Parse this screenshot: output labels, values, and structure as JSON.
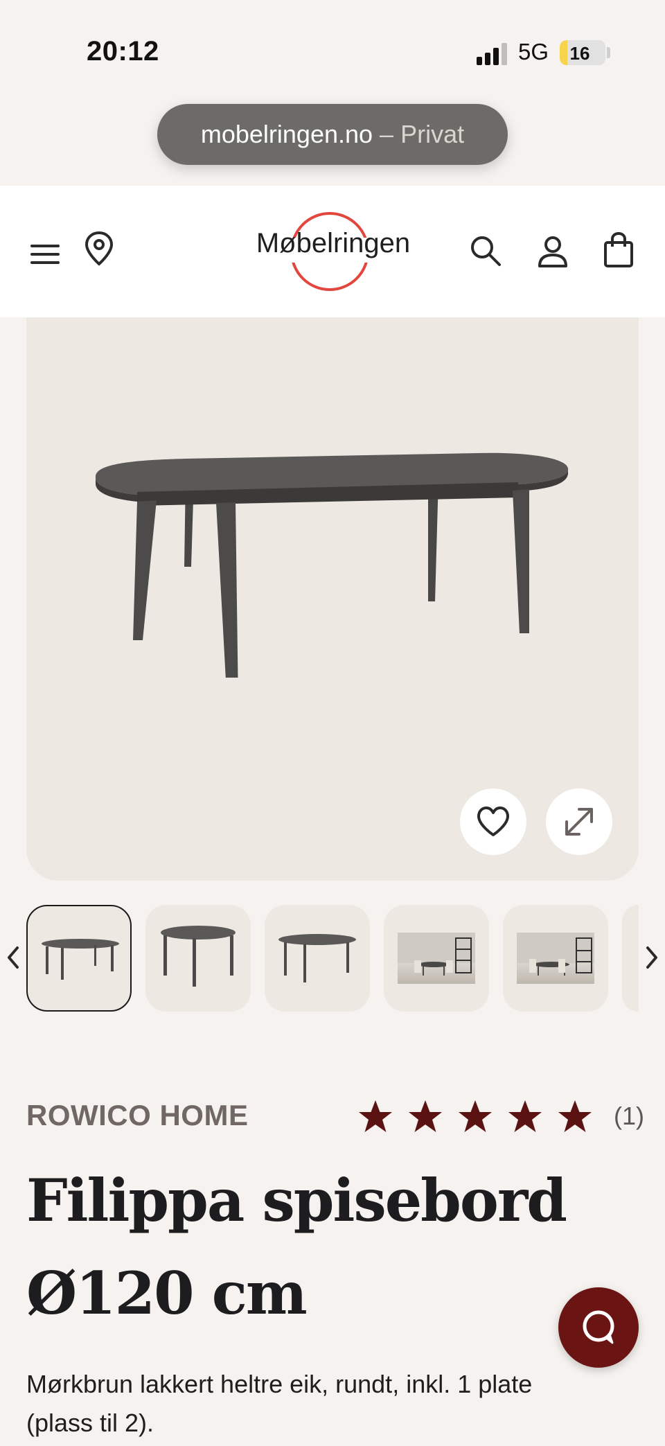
{
  "status_bar": {
    "time": "20:12",
    "network": "5G",
    "battery_level": "16",
    "battery_fraction": 0.16
  },
  "browser": {
    "url_domain": "mobelringen.no",
    "url_separator": "–",
    "url_mode": "Privat"
  },
  "header": {
    "logo_text": "Møbelringen",
    "icons": [
      "menu-icon",
      "location-pin-icon",
      "search-icon",
      "account-icon",
      "shopping-bag-icon"
    ],
    "accent_color": "#e2463d"
  },
  "gallery": {
    "thumbnail_count": 6,
    "active_index": 0
  },
  "product": {
    "brand": "ROWICO HOME",
    "rating": 5,
    "review_count": "(1)",
    "title": "Filippa spisebord Ø120 cm",
    "description": "Mørkbrun lakkert heltre eik, rundt, inkl. 1 plate (plass til 2).",
    "star_color": "#5a1212"
  },
  "chat": {
    "icon": "chat-bubble-icon",
    "color": "#6a1414"
  }
}
